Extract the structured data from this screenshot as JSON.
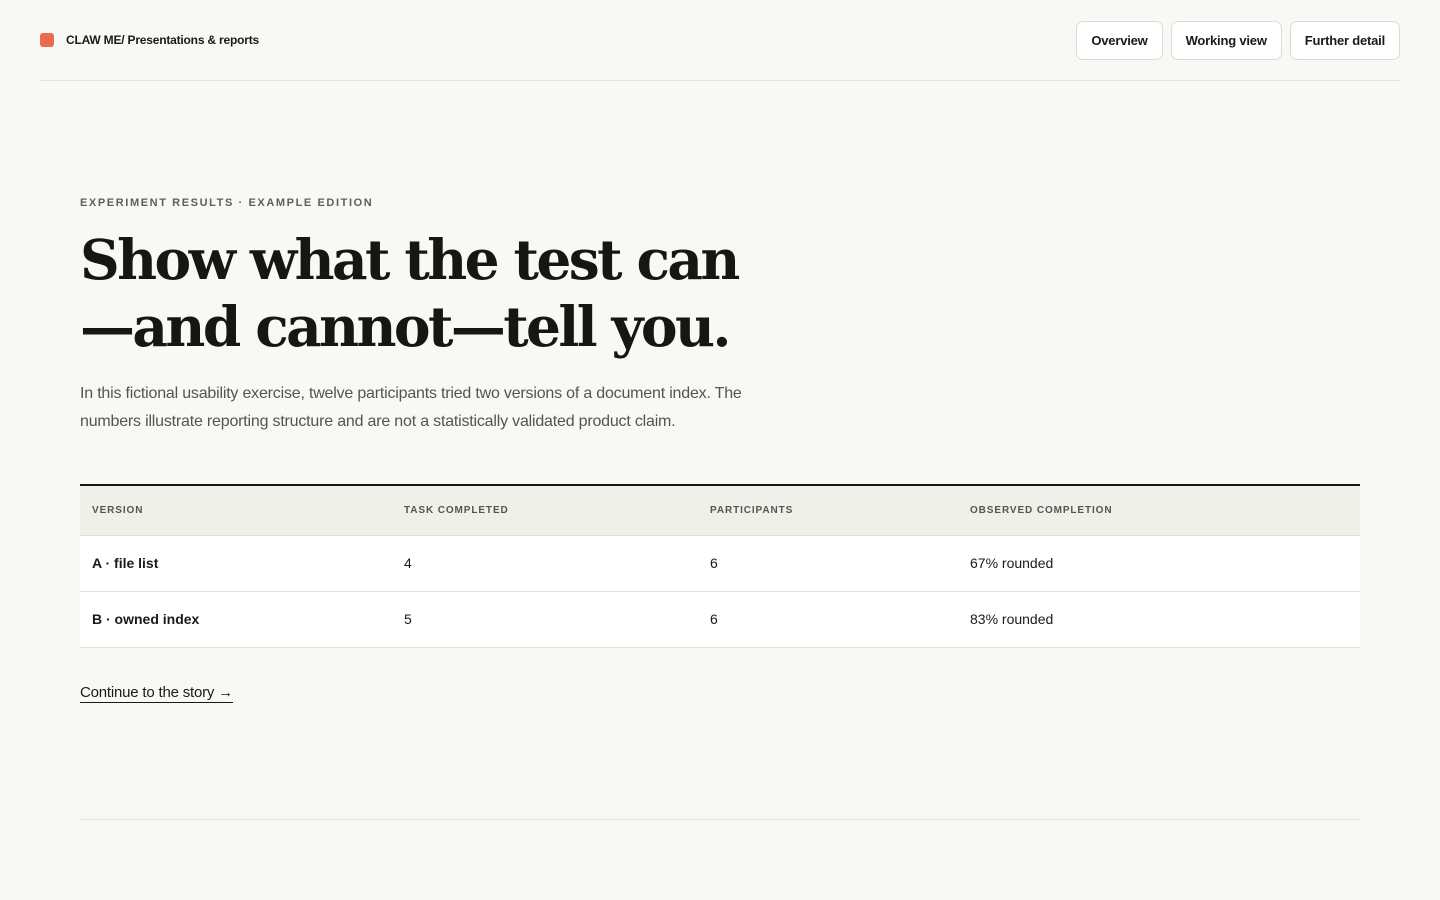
{
  "header": {
    "brand": "CLAW ME/ Presentations & reports",
    "nav": [
      {
        "label": "Overview"
      },
      {
        "label": "Working view"
      },
      {
        "label": "Further detail"
      }
    ]
  },
  "hero": {
    "eyebrow": "EXPERIMENT RESULTS · EXAMPLE EDITION",
    "headline_line1": "Show what the test can",
    "headline_line2": "—and cannot—tell you.",
    "lede": "In this fictional usability exercise, twelve participants tried two versions of a document index. The numbers illustrate reporting structure and are not a statistically validated product claim."
  },
  "table": {
    "headers": [
      "VERSION",
      "TASK COMPLETED",
      "PARTICIPANTS",
      "OBSERVED COMPLETION"
    ],
    "rows": [
      [
        "A · file list",
        "4",
        "6",
        "67% rounded"
      ],
      [
        "B · owned index",
        "5",
        "6",
        "83% rounded"
      ]
    ]
  },
  "cta": {
    "label": "Continue to the story →"
  },
  "colors": {
    "brand": "#ec6a4f",
    "background": "#f8f8f4"
  }
}
